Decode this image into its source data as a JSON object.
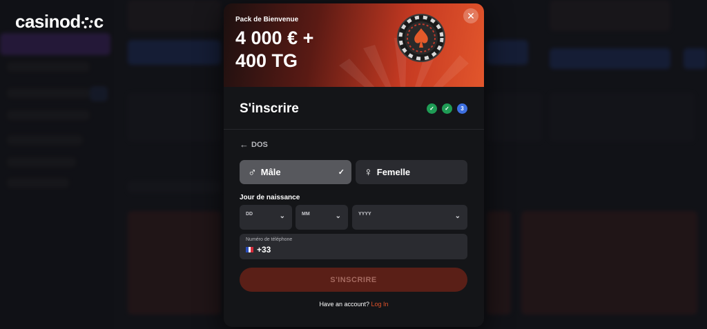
{
  "brand": {
    "logo_pre": "casinod",
    "logo_post": "c"
  },
  "banner": {
    "subtitle": "Pack de Bienvenue",
    "line1": "4 000 € +",
    "line2": "400 TG"
  },
  "modal": {
    "title": "S'inscrire",
    "steps": [
      "",
      "",
      "3"
    ],
    "back_label": "DOS",
    "gender": {
      "male": "Mâle",
      "female": "Femelle"
    },
    "dob": {
      "label": "Jour de naissance",
      "day_placeholder": "DD",
      "month_placeholder": "MM",
      "year_placeholder": "YYYY"
    },
    "phone": {
      "label": "Numéro de téléphone",
      "code": "+33",
      "country": "France"
    },
    "submit_label": "S'INSCRIRE",
    "footer": {
      "prompt": "Have an account?",
      "link": "Log In"
    }
  },
  "icons": {
    "close": "close-icon",
    "back": "arrow-left-icon",
    "male": "male-symbol-icon",
    "female": "female-symbol-icon",
    "check": "check-icon",
    "chevron": "chevron-down-icon"
  },
  "colors": {
    "accent": "#e3522a",
    "step_done": "#1f9c55",
    "step_active": "#3d6fe0",
    "modal_bg": "#141518",
    "field_bg": "#2a2b30",
    "selected_bg": "#57585d"
  }
}
